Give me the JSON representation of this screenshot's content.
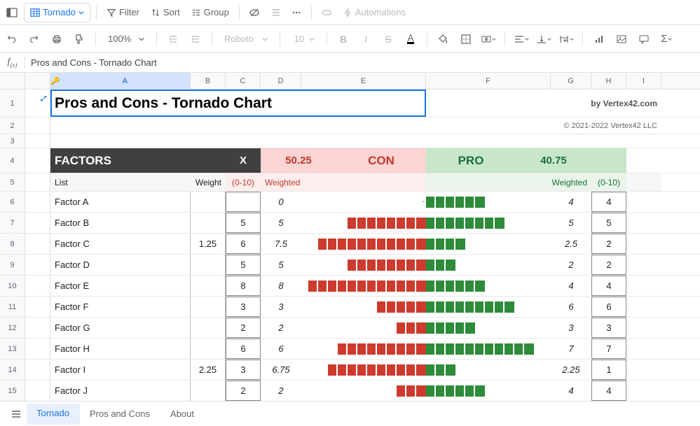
{
  "toolbar": {
    "tab_name": "Tornado",
    "filter": "Filter",
    "sort": "Sort",
    "group": "Group",
    "automations": "Automations",
    "zoom": "100%",
    "font": "Roboto",
    "font_size": "10"
  },
  "formula": {
    "content": "Pros and Cons - Tornado Chart"
  },
  "columns": [
    "A",
    "B",
    "C",
    "D",
    "E",
    "F",
    "G",
    "H",
    "I"
  ],
  "title": "Pros and Cons - Tornado Chart",
  "byline": "by Vertex42.com",
  "copyright": "© 2021-2022 Vertex42 LLC",
  "headers": {
    "factors": "FACTORS",
    "x": "X",
    "con_total": "50.25",
    "con": "CON",
    "pro": "PRO",
    "pro_total": "40.75",
    "list": "List",
    "weight": "Weight",
    "range_con": "(0-10)",
    "weighted_con": "Weighted",
    "weighted_pro": "Weighted",
    "range_pro": "(0-10)"
  },
  "chart_data": {
    "type": "bar",
    "title": "Pros and Cons - Tornado Chart",
    "factors": [
      {
        "name": "Factor A",
        "weight": "",
        "con_raw": "",
        "con_weighted": "0",
        "con_segs": 0,
        "con_dash": true,
        "pro_segs": 6,
        "pro_weighted": "4",
        "pro_raw": "4"
      },
      {
        "name": "Factor B",
        "weight": "",
        "con_raw": "5",
        "con_weighted": "5",
        "con_segs": 8,
        "pro_segs": 8,
        "pro_weighted": "5",
        "pro_raw": "5"
      },
      {
        "name": "Factor C",
        "weight": "1.25",
        "con_raw": "6",
        "con_weighted": "7.5",
        "con_segs": 11,
        "pro_segs": 4,
        "pro_weighted": "2.5",
        "pro_raw": "2"
      },
      {
        "name": "Factor D",
        "weight": "",
        "con_raw": "5",
        "con_weighted": "5",
        "con_segs": 8,
        "pro_segs": 3,
        "pro_weighted": "2",
        "pro_raw": "2"
      },
      {
        "name": "Factor E",
        "weight": "",
        "con_raw": "8",
        "con_weighted": "8",
        "con_segs": 12,
        "pro_segs": 6,
        "pro_weighted": "4",
        "pro_raw": "4"
      },
      {
        "name": "Factor F",
        "weight": "",
        "con_raw": "3",
        "con_weighted": "3",
        "con_segs": 5,
        "pro_segs": 9,
        "pro_weighted": "6",
        "pro_raw": "6"
      },
      {
        "name": "Factor G",
        "weight": "",
        "con_raw": "2",
        "con_weighted": "2",
        "con_segs": 3,
        "pro_segs": 5,
        "pro_weighted": "3",
        "pro_raw": "3"
      },
      {
        "name": "Factor H",
        "weight": "",
        "con_raw": "6",
        "con_weighted": "6",
        "con_segs": 9,
        "pro_segs": 11,
        "pro_weighted": "7",
        "pro_raw": "7"
      },
      {
        "name": "Factor I",
        "weight": "2.25",
        "con_raw": "3",
        "con_weighted": "6.75",
        "con_segs": 10,
        "pro_segs": 3,
        "pro_weighted": "2.25",
        "pro_raw": "1"
      },
      {
        "name": "Factor J",
        "weight": "",
        "con_raw": "2",
        "con_weighted": "2",
        "con_segs": 3,
        "pro_segs": 6,
        "pro_weighted": "4",
        "pro_raw": "4"
      }
    ]
  },
  "sheets": [
    "Tornado",
    "Pros and Cons",
    "About"
  ]
}
